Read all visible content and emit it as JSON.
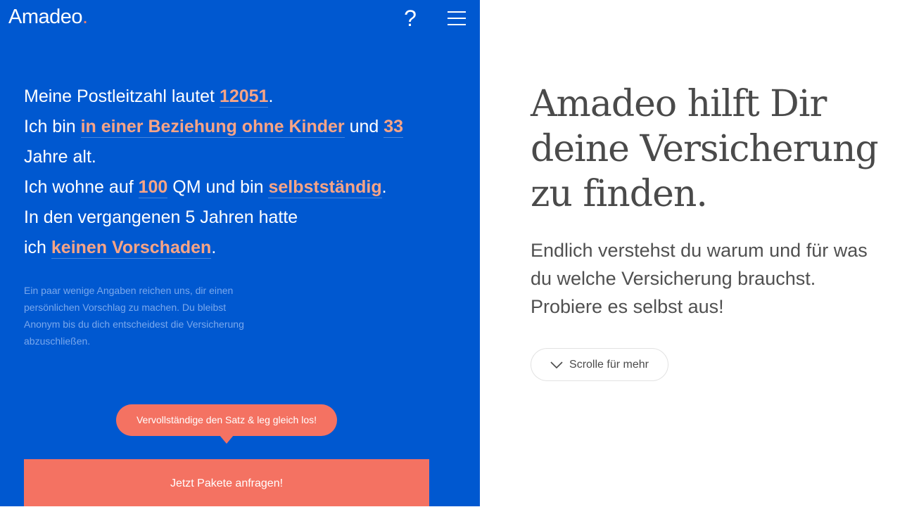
{
  "header": {
    "logo_text": "Amadeo",
    "logo_dot": ".",
    "help_label": "?"
  },
  "form": {
    "line1": {
      "prefix": "Meine Postleitzahl lautet ",
      "zip": "12051",
      "suffix": "."
    },
    "line2": {
      "prefix": "Ich bin ",
      "relationship": "in einer Beziehung ohne Kinder",
      "middle": " und ",
      "age": "33"
    },
    "line3": {
      "text": "Jahre alt."
    },
    "line4": {
      "prefix": "Ich wohne auf ",
      "area": "100",
      "middle": " QM und bin ",
      "occupation": "selbstständig",
      "suffix": "."
    },
    "line5": {
      "text": "In den vergangenen 5 Jahren hatte"
    },
    "line6": {
      "prefix": "ich ",
      "damage": "keinen Vorschaden",
      "suffix": "."
    },
    "note": "Ein paar wenige Angaben reichen uns, dir einen persönlichen Vorschlag zu machen. Du bleibst Anonym bis du dich entscheidest die Versicherung abzuschließen."
  },
  "tooltip": "Vervollständige den Satz & leg gleich los!",
  "cta_label": "Jetzt Pakete anfragen!",
  "hero": {
    "headline": "Amadeo hilft Dir deine Versicherung zu finden.",
    "subtext": "Endlich verstehst du warum und für was du welche Versicherung brauchst. Probiere es selbst aus!",
    "scroll_label": "Scrolle für mehr",
    "scroll_icon": "chevron-down-icon"
  },
  "colors": {
    "panel_blue": "#0058d0",
    "accent_coral": "#f47262",
    "highlight_peach": "#f7a486"
  }
}
